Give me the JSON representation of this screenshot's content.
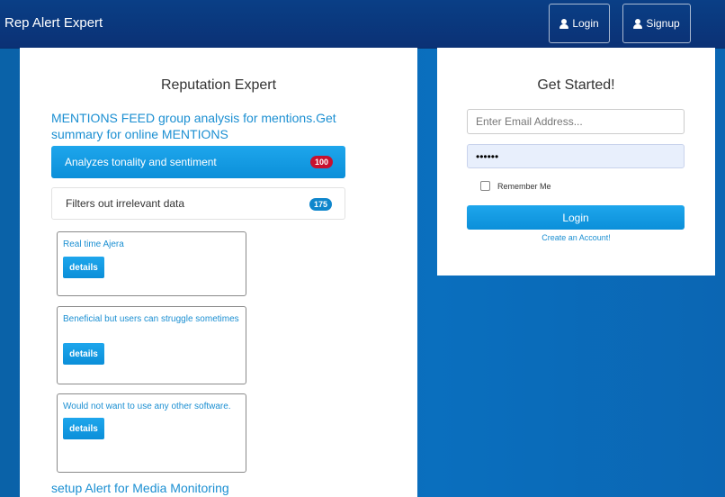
{
  "navbar": {
    "brand": "Rep Alert Expert",
    "login_label": "Login",
    "signup_label": "Signup"
  },
  "left": {
    "title": "Reputation Expert",
    "feed_heading": "MENTIONS FEED group analysis for mentions.Get summary for online MENTIONS",
    "list": [
      {
        "label": "Analyzes tonality and sentiment",
        "badge": "100",
        "badge_color": "#c8102e"
      },
      {
        "label": "Filters out irrelevant data",
        "badge": "175",
        "badge_color": "#0f86cc"
      }
    ],
    "cards": [
      {
        "text": "Real time Ajera",
        "button": "details"
      },
      {
        "text": "Beneficial but users can struggle sometimes",
        "button": "details"
      },
      {
        "text": "Would not want to use any other software.",
        "button": "details"
      }
    ],
    "setup_heading": "setup Alert for Media Monitoring"
  },
  "right": {
    "title": "Get Started!",
    "email_placeholder": "Enter Email Address...",
    "password_value": "••••••",
    "remember_label": "Remember Me",
    "login_label": "Login",
    "create_account": "Create an Account!"
  },
  "colors": {
    "accent": "#1b8fd2",
    "navbar": "#0b3175",
    "background": "#0a6fbe"
  }
}
